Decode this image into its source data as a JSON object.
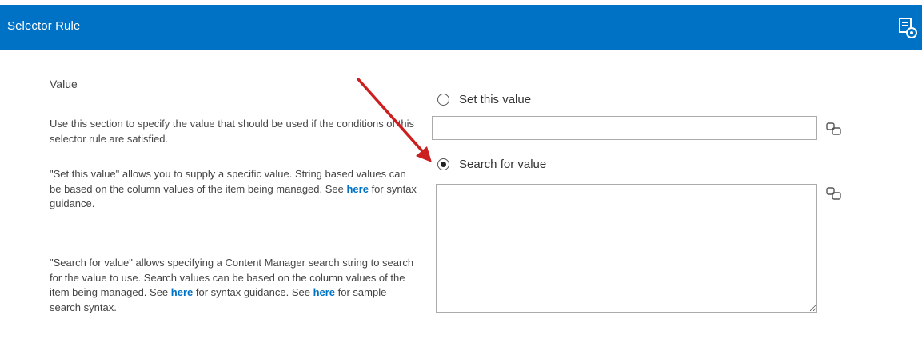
{
  "header": {
    "title": "Selector Rule",
    "icon": "settings-ribbon-icon",
    "background": "#0072c6"
  },
  "section": {
    "title": "Value",
    "paragraph1": "Use this section to specify the value that should be used if the conditions of this selector rule are satisfied.",
    "paragraph2": {
      "text_before": "\"Set this value\" allows you to supply a specific value. String based values can be based on the column values of the item being managed. See ",
      "link": "here",
      "text_after": " for syntax guidance."
    },
    "paragraph3": {
      "text_before": "\"Search for value\" allows specifying a Content Manager search string to search for the value to use. Search values can be based on the column values of the item being managed. See ",
      "link1": "here",
      "text_middle": " for syntax guidance. See ",
      "link2": "here",
      "text_after": " for sample search syntax."
    }
  },
  "options": {
    "set_value": {
      "label": "Set this value",
      "selected": false,
      "value": ""
    },
    "search_value": {
      "label": "Search for value",
      "selected": true,
      "value": ""
    }
  },
  "annotation": {
    "arrow_color": "#cc1f1f"
  },
  "colors": {
    "link": "#0072c6",
    "text": "#444444"
  }
}
